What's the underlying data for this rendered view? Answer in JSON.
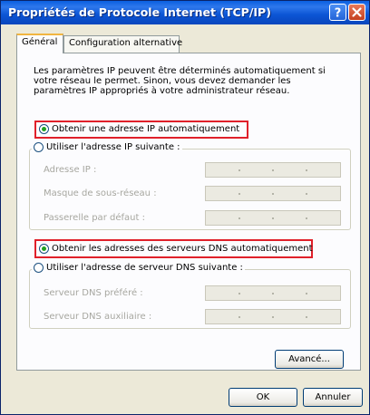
{
  "window": {
    "title": "Propriétés de Protocole Internet (TCP/IP)",
    "help_icon": "question-mark-icon",
    "close_icon": "close-icon"
  },
  "tabs": [
    {
      "label": "Général",
      "active": true
    },
    {
      "label": "Configuration alternative",
      "active": false
    }
  ],
  "description": "Les paramètres IP peuvent être déterminés automatiquement si votre réseau le permet. Sinon, vous devez demander les paramètres IP appropriés à votre administrateur réseau.",
  "ip": {
    "auto_label": "Obtenir une adresse IP automatiquement",
    "auto_selected": true,
    "manual_label": "Utiliser l'adresse IP suivante :",
    "fields": [
      {
        "label": "Adresse IP :",
        "value": ""
      },
      {
        "label": "Masque de sous-réseau :",
        "value": ""
      },
      {
        "label": "Passerelle par défaut :",
        "value": ""
      }
    ]
  },
  "dns": {
    "auto_label": "Obtenir les adresses des serveurs DNS automatiquement",
    "auto_selected": true,
    "manual_label": "Utiliser l'adresse de serveur DNS suivante :",
    "fields": [
      {
        "label": "Serveur DNS préféré :",
        "value": ""
      },
      {
        "label": "Serveur DNS auxiliaire :",
        "value": ""
      }
    ]
  },
  "buttons": {
    "advanced": "Avancé...",
    "ok": "OK",
    "cancel": "Annuler"
  },
  "colors": {
    "titlebar": "#0a5fe0",
    "highlight": "#e0202a",
    "radio_selected": "#21a121"
  }
}
